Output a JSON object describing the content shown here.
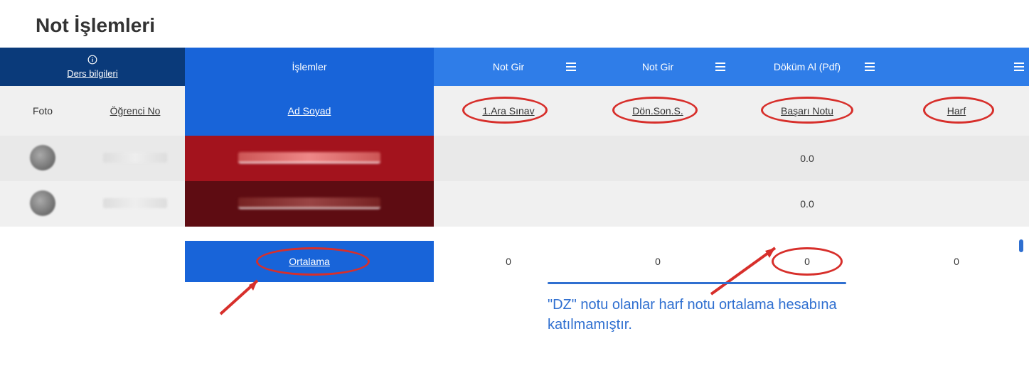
{
  "title": "Not İşlemleri",
  "actionbar": {
    "ders_bilgileri": "Ders bilgileri",
    "islemler": "İşlemler",
    "col1_btn": "Not Gir",
    "col2_btn": "Not Gir",
    "col3_btn": "Döküm Al (Pdf)",
    "col4_btn": ""
  },
  "headers": {
    "foto": "Foto",
    "ogrno": "Öğrenci No",
    "adsoyad": "Ad Soyad",
    "c1": "1.Ara Sınav",
    "c2": "Dön.Son.S.",
    "c3": "Başarı Notu",
    "c4": "Harf"
  },
  "rows": [
    {
      "c1": "",
      "c2": "",
      "c3": "0.0",
      "c4": ""
    },
    {
      "c1": "",
      "c2": "",
      "c3": "0.0",
      "c4": ""
    }
  ],
  "summary": {
    "label": "Ortalama",
    "c1": "0",
    "c2": "0",
    "c3": "0",
    "c4": "0"
  },
  "annotation": {
    "text": "\"DZ\" notu olanlar harf notu ortalama hesabına katılmamıştır."
  }
}
